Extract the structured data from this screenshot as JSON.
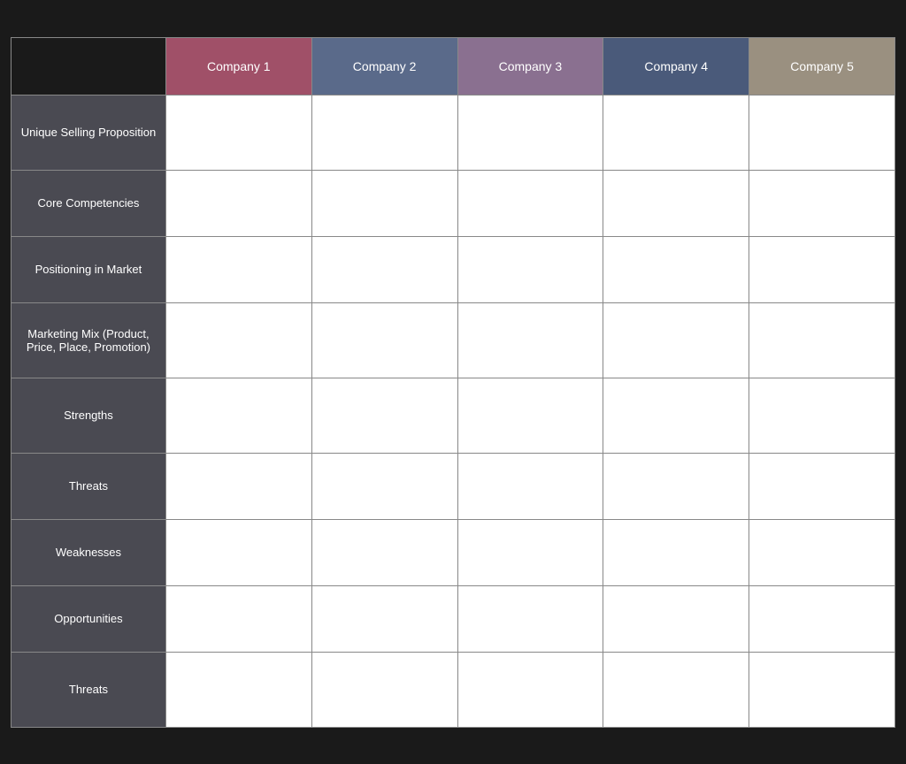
{
  "header": {
    "empty_label": "",
    "companies": [
      {
        "id": "company1",
        "label": "Company 1"
      },
      {
        "id": "company2",
        "label": "Company 2"
      },
      {
        "id": "company3",
        "label": "Company 3"
      },
      {
        "id": "company4",
        "label": "Company 4"
      },
      {
        "id": "company5",
        "label": "Company 5"
      }
    ]
  },
  "rows": [
    {
      "id": "usp",
      "label": "Unique Selling Proposition"
    },
    {
      "id": "core",
      "label": "Core Competencies"
    },
    {
      "id": "positioning",
      "label": "Positioning in Market"
    },
    {
      "id": "marketing",
      "label": "Marketing Mix (Product, Price, Place, Promotion)"
    },
    {
      "id": "strengths",
      "label": "Strengths"
    },
    {
      "id": "threats1",
      "label": "Threats"
    },
    {
      "id": "weaknesses",
      "label": "Weaknesses"
    },
    {
      "id": "opportunities",
      "label": "Opportunities"
    },
    {
      "id": "threats2",
      "label": "Threats"
    }
  ]
}
